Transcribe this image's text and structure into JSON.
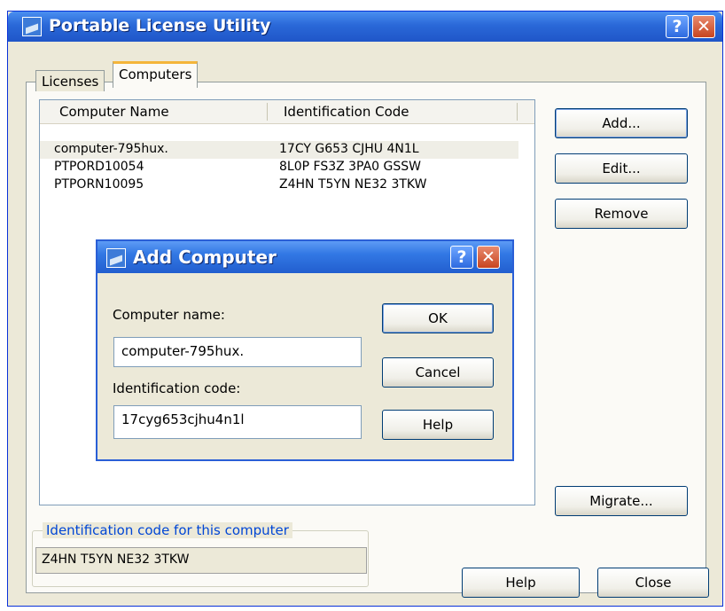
{
  "window": {
    "title": "Portable License Utility",
    "help_glyph": "?",
    "close_glyph": "✕"
  },
  "tabs": [
    {
      "label": "Licenses",
      "active": false
    },
    {
      "label": "Computers",
      "active": true
    }
  ],
  "list": {
    "columns": [
      "Computer Name",
      "Identification Code"
    ],
    "rows": [
      {
        "name": "computer-795hux.",
        "code": "17CY G653 CJHU 4N1L",
        "selected": true
      },
      {
        "name": "PTPORD10054",
        "code": "8L0P FS3Z 3PA0 GSSW",
        "selected": false
      },
      {
        "name": "PTPORN10095",
        "code": "Z4HN T5YN NE32 3TKW",
        "selected": false
      }
    ]
  },
  "side_buttons": {
    "add": "Add...",
    "edit": "Edit...",
    "remove": "Remove",
    "migrate": "Migrate..."
  },
  "id_group": {
    "label": "Identification code for this computer",
    "value": "Z4HN T5YN NE32 3TKW"
  },
  "footer_buttons": {
    "help": "Help",
    "close": "Close"
  },
  "dialog": {
    "title": "Add Computer",
    "help_glyph": "?",
    "close_glyph": "✕",
    "computer_name_label": "Computer name:",
    "computer_name_value": "computer-795hux.",
    "id_code_label": "Identification code:",
    "id_code_value": "17cyg653cjhu4n1l",
    "ok": "OK",
    "cancel": "Cancel",
    "help": "Help"
  },
  "colors": {
    "titlebar": "#2a68d8",
    "window_bg": "#ECE9D8",
    "accent_tab": "#f4b53a",
    "group_label": "#0046d5"
  }
}
